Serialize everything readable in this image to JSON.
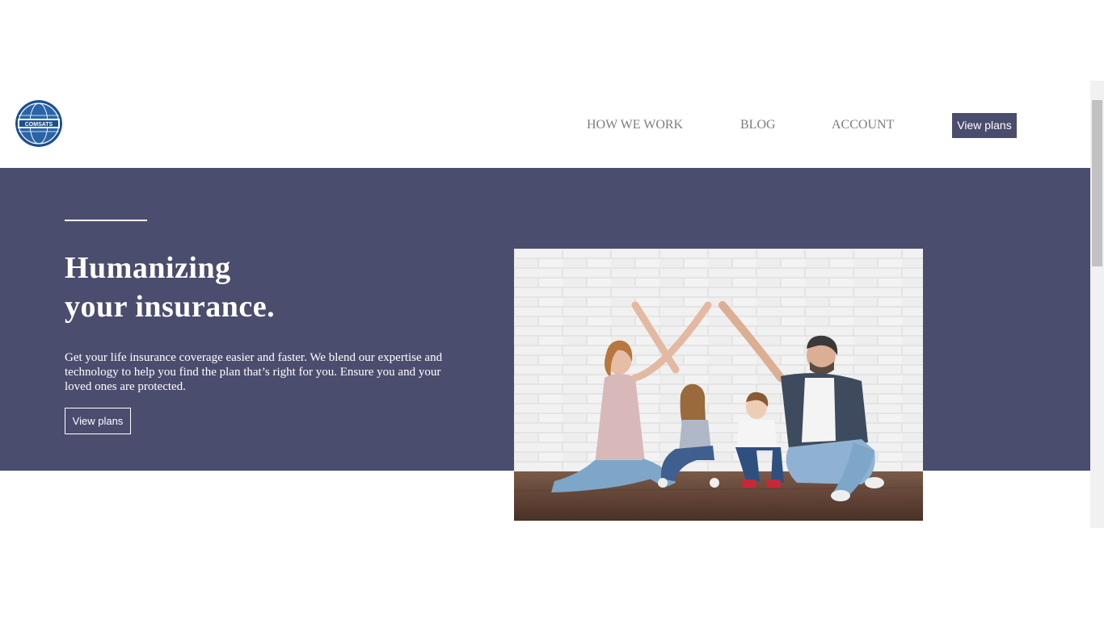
{
  "header": {
    "logo_text": "COMSATS",
    "nav": {
      "how_we_work": "HOW WE WORK",
      "blog": "BLOG",
      "account": "ACCOUNT"
    },
    "cta_label": "View plans"
  },
  "hero": {
    "title_line1": "Humanizing",
    "title_line2": "your insurance.",
    "description": "Get your life insurance coverage easier and faster. We blend our expertise and technology to help you find the plan that’s right for you. Ensure you and your loved ones are protected.",
    "button_label": "View plans",
    "image_alt": "Family sitting on a wooden floor against a white brick wall, parents forming a roof over their two children with their hands"
  },
  "colors": {
    "brand": "#4b4d6e",
    "nav_text": "#7d7d7d",
    "white": "#ffffff"
  }
}
